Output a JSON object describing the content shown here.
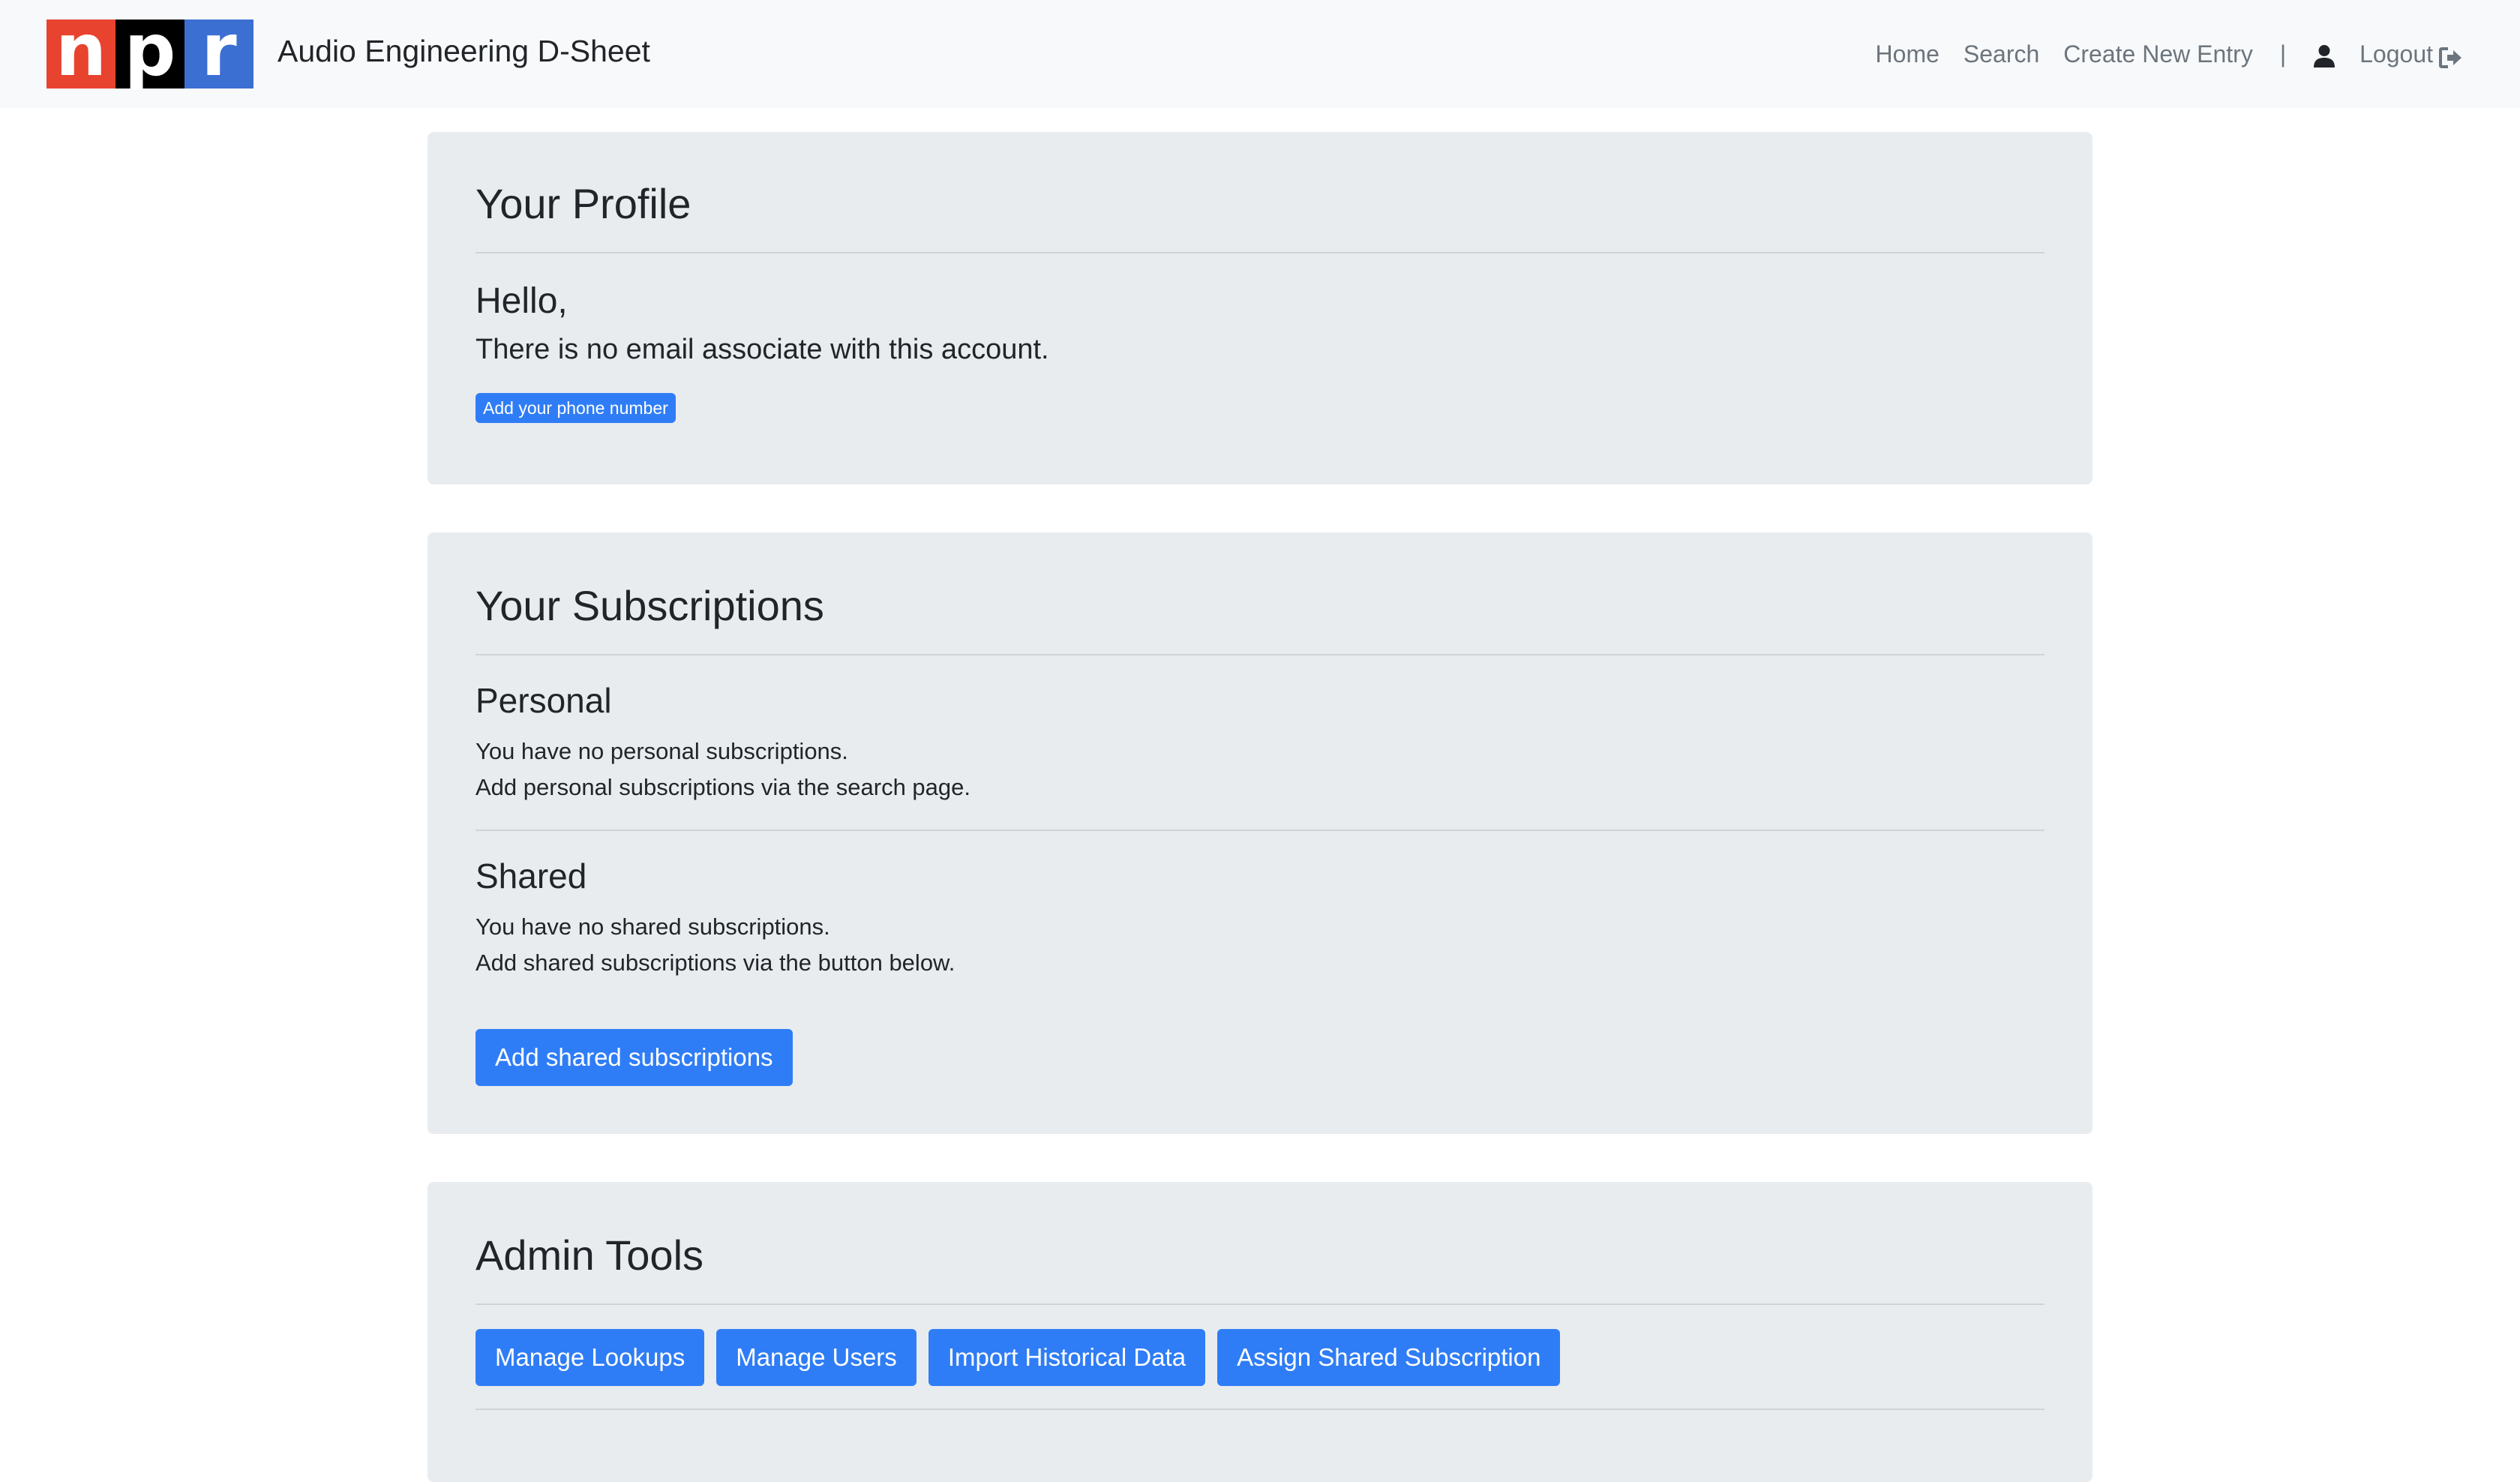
{
  "navbar": {
    "logo_letters": [
      "n",
      "p",
      "r"
    ],
    "brand": "Audio Engineering D-Sheet",
    "links": [
      "Home",
      "Search",
      "Create New Entry"
    ],
    "separator": "|",
    "logout": "Logout",
    "icons": {
      "user": "user-icon",
      "logout": "sign-out-icon"
    }
  },
  "profile": {
    "title": "Your Profile",
    "greeting": "Hello,",
    "email_status": "There is no email associate with this account.",
    "phone_button": "Add your phone number"
  },
  "subscriptions": {
    "title": "Your Subscriptions",
    "personal": {
      "heading": "Personal",
      "line1": "You have no personal subscriptions.",
      "line2": "Add personal subscriptions via the search page."
    },
    "shared": {
      "heading": "Shared",
      "line1": "You have no shared subscriptions.",
      "line2": "Add shared subscriptions via the button below.",
      "button": "Add shared subscriptions"
    }
  },
  "admin": {
    "title": "Admin Tools",
    "buttons": [
      "Manage Lookups",
      "Manage Users",
      "Import Historical Data",
      "Assign Shared Subscription"
    ]
  },
  "colors": {
    "primary": "#2f7df6",
    "card_bg": "#e9ecef",
    "navbar_bg": "#f8f9fa",
    "npr_red": "#e8432f",
    "npr_black": "#000000",
    "npr_blue": "#3b6fd2"
  }
}
